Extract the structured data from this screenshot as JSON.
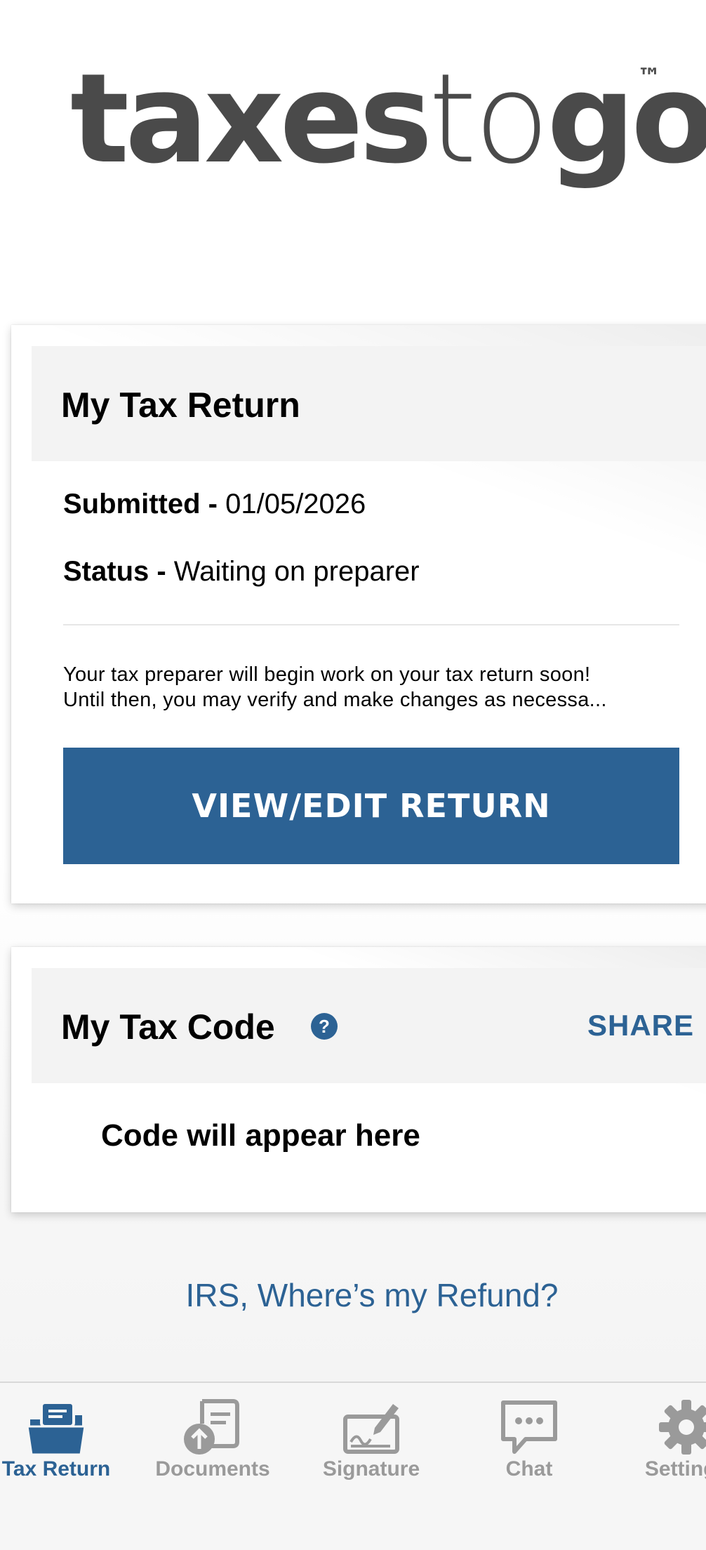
{
  "logo": {
    "part1": "taxes",
    "part2": "to",
    "part3": "go",
    "trademark": "™"
  },
  "tax_return_card": {
    "title": "My Tax Return",
    "submitted_label": "Submitted - ",
    "submitted_value": "01/05/2026",
    "status_label": "Status - ",
    "status_value": "Waiting on preparer",
    "description_line1": "Your tax preparer will begin work on your tax return soon!",
    "description_line2": "Until then, you may verify and make changes as necessa...",
    "button_label": "VIEW/EDIT RETURN"
  },
  "tax_code_card": {
    "title": "My Tax Code",
    "help_icon": "?",
    "share_label": "SHARE",
    "placeholder": "Code will appear here"
  },
  "refund_link": "IRS, Where’s my Refund?",
  "tabbar": {
    "tabs": [
      {
        "label": "Tax Return",
        "icon": "folder-icon",
        "active": true
      },
      {
        "label": "Documents",
        "icon": "document-upload-icon",
        "active": false
      },
      {
        "label": "Signature",
        "icon": "signature-icon",
        "active": false
      },
      {
        "label": "Chat",
        "icon": "chat-icon",
        "active": false
      },
      {
        "label": "Settings",
        "icon": "gear-icon",
        "active": false
      }
    ]
  },
  "colors": {
    "accent": "#2c6294",
    "inactive_tab": "#9a9a9a",
    "logo": "#4a4a4a"
  }
}
